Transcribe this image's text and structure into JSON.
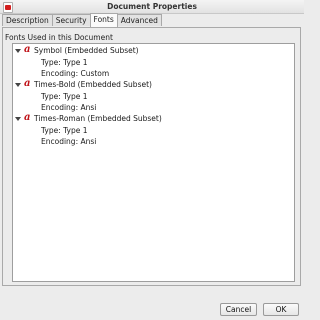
{
  "window": {
    "title": "Document Properties"
  },
  "tabs": [
    {
      "label": "Description",
      "active": false
    },
    {
      "label": "Security",
      "active": false
    },
    {
      "label": "Fonts",
      "active": true
    },
    {
      "label": "Advanced",
      "active": false
    }
  ],
  "fonts_panel": {
    "group_label": "Fonts Used in this Document",
    "fonts": [
      {
        "name": "Symbol (Embedded Subset)",
        "type": "Type: Type 1",
        "encoding": "Encoding: Custom",
        "icon": "font-icon"
      },
      {
        "name": "Times-Bold (Embedded Subset)",
        "type": "Type: Type 1",
        "encoding": "Encoding: Ansi",
        "icon": "font-icon"
      },
      {
        "name": "Times-Roman (Embedded Subset)",
        "type": "Type: Type 1",
        "encoding": "Encoding: Ansi",
        "icon": "font-icon"
      }
    ]
  },
  "buttons": {
    "cancel": "Cancel",
    "ok": "OK"
  },
  "colors": {
    "font_icon": "#c0141a",
    "background": "#ececec"
  }
}
